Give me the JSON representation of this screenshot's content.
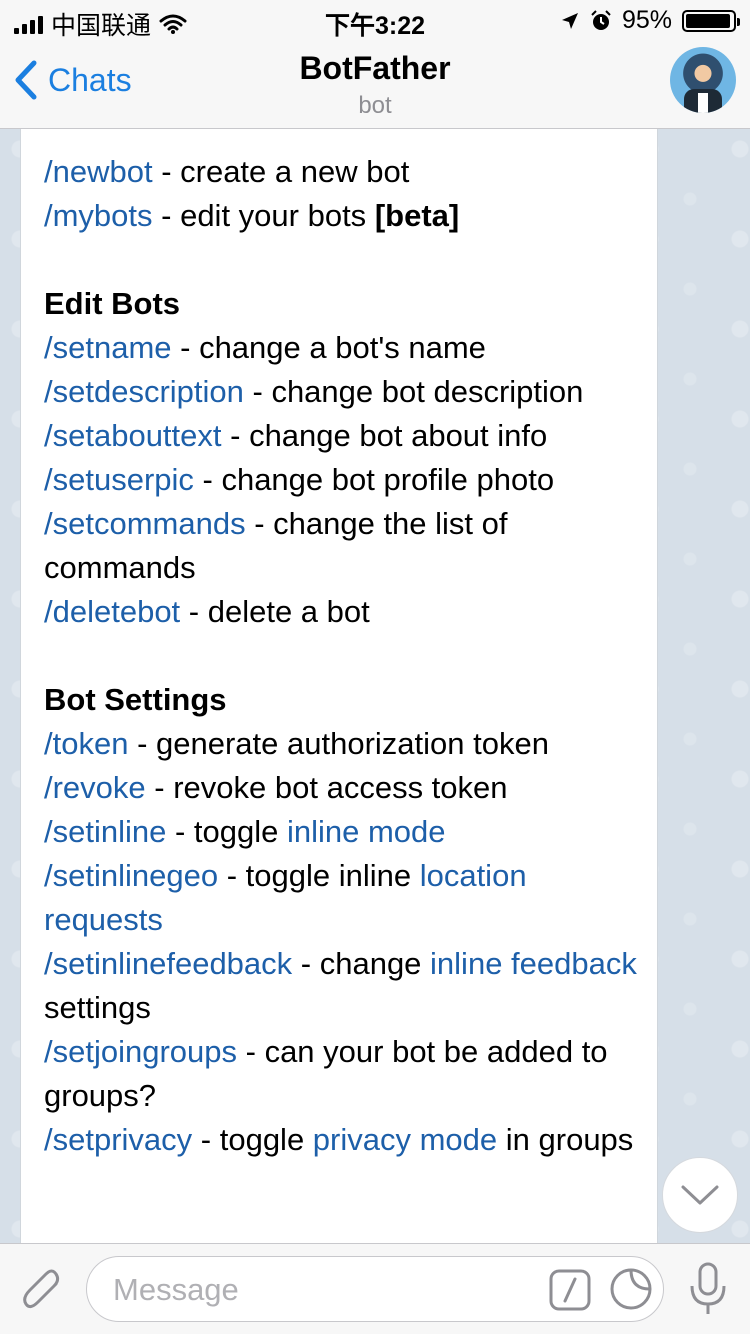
{
  "status_bar": {
    "carrier": "中国联通",
    "time": "下午3:22",
    "battery_text": "95%",
    "battery_level": 0.95
  },
  "nav": {
    "back_label": "Chats",
    "title": "BotFather",
    "subtitle": "bot"
  },
  "message": {
    "lines": [
      {
        "cmd": "/newbot",
        "text": " - create a new bot"
      },
      {
        "cmd": "/mybots",
        "text": " - edit your bots ",
        "bold": "[beta]"
      },
      {
        "heading": "Edit Bots"
      },
      {
        "cmd": "/setname",
        "text": " - change a bot's name"
      },
      {
        "cmd": "/setdescription",
        "text": " - change bot description"
      },
      {
        "cmd": "/setabouttext",
        "text": " - change bot about info"
      },
      {
        "cmd": "/setuserpic",
        "text": " - change bot profile photo"
      },
      {
        "cmd": "/setcommands",
        "text": " - change the list of commands"
      },
      {
        "cmd": "/deletebot",
        "text": " - delete a bot"
      },
      {
        "heading": "Bot Settings"
      },
      {
        "cmd": "/token",
        "text": " - generate authorization token"
      },
      {
        "cmd": "/revoke",
        "text": " - revoke bot access token"
      },
      {
        "cmd": "/setinline",
        "text": " - toggle ",
        "link": "inline mode"
      },
      {
        "cmd": "/setinlinegeo",
        "text": " - toggle inline ",
        "link": "location requests"
      },
      {
        "cmd": "/setinlinefeedback",
        "text": " - change ",
        "link": "inline feedback",
        "after": " settings"
      },
      {
        "cmd": "/setjoingroups",
        "text": " - can your bot be added to groups?"
      },
      {
        "cmd": "/setprivacy",
        "text": " - toggle ",
        "link": "privacy mode",
        "after": " in groups"
      }
    ]
  },
  "input": {
    "placeholder": "Message"
  },
  "icons": {
    "back": "chevron-left-icon",
    "attach": "paperclip-icon",
    "commands": "slash-command-icon",
    "sticker": "sticker-icon",
    "mic": "microphone-icon",
    "scroll": "chevron-down-icon"
  },
  "colors": {
    "accent": "#1b7fe0",
    "command_link": "#1d5fa9"
  }
}
